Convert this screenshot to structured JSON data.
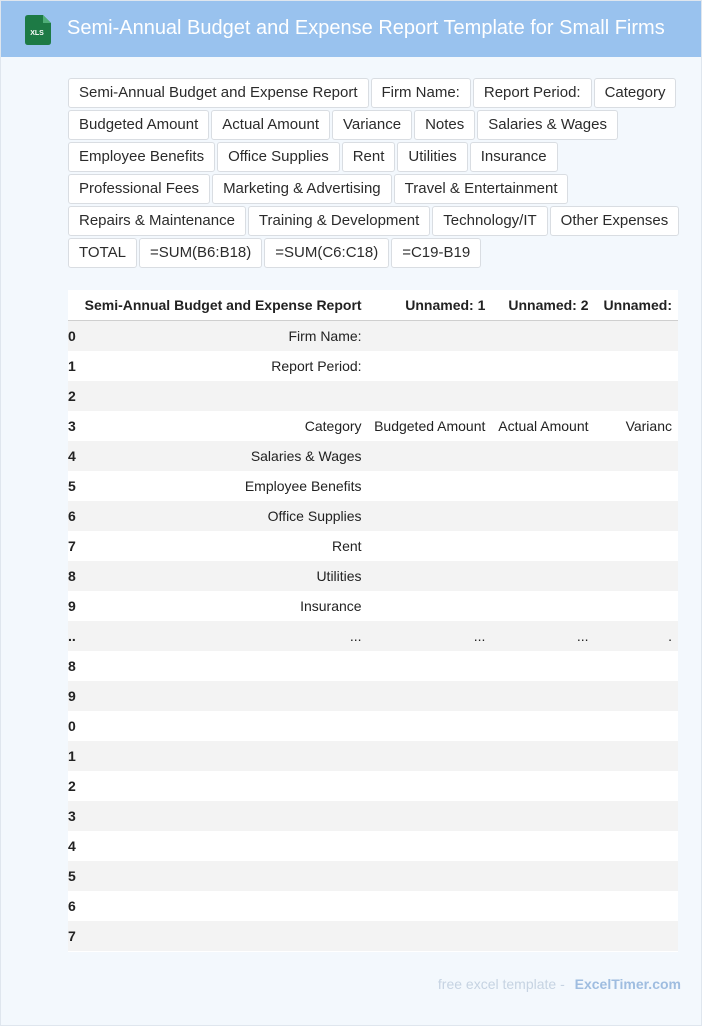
{
  "header": {
    "icon_text": "XLS",
    "title": "Semi-Annual Budget and Expense Report Template for Small Firms"
  },
  "tags": [
    "Semi-Annual Budget and Expense Report",
    "Firm Name:",
    "Report Period:",
    "Category",
    "Budgeted Amount",
    "Actual Amount",
    "Variance",
    "Notes",
    "Salaries & Wages",
    "Employee Benefits",
    "Office Supplies",
    "Rent",
    "Utilities",
    "Insurance",
    "Professional Fees",
    "Marketing & Advertising",
    "Travel & Entertainment",
    "Repairs & Maintenance",
    "Training & Development",
    "Technology/IT",
    "Other Expenses",
    "TOTAL",
    "=SUM(B6:B18)",
    "=SUM(C6:C18)",
    "=C19-B19"
  ],
  "table": {
    "columns": [
      "",
      "Semi-Annual Budget and Expense Report",
      "Unnamed: 1",
      "Unnamed: 2",
      "Unnamed:"
    ],
    "rows": [
      [
        "0",
        "Firm Name:",
        "",
        "",
        ""
      ],
      [
        "1",
        "Report Period:",
        "",
        "",
        ""
      ],
      [
        "2",
        "",
        "",
        "",
        ""
      ],
      [
        "3",
        "Category",
        "Budgeted Amount",
        "Actual Amount",
        "Varianc"
      ],
      [
        "4",
        "Salaries & Wages",
        "",
        "",
        ""
      ],
      [
        "5",
        "Employee Benefits",
        "",
        "",
        ""
      ],
      [
        "6",
        "Office Supplies",
        "",
        "",
        ""
      ],
      [
        "7",
        "Rent",
        "",
        "",
        ""
      ],
      [
        "8",
        "Utilities",
        "",
        "",
        ""
      ],
      [
        "9",
        "Insurance",
        "",
        "",
        ""
      ],
      [
        "..",
        "...",
        "...",
        "...",
        "."
      ],
      [
        "8",
        "",
        "",
        "",
        ""
      ],
      [
        "9",
        "",
        "",
        "",
        ""
      ],
      [
        "0",
        "",
        "",
        "",
        ""
      ],
      [
        "1",
        "",
        "",
        "",
        ""
      ],
      [
        "2",
        "",
        "",
        "",
        ""
      ],
      [
        "3",
        "",
        "",
        "",
        ""
      ],
      [
        "4",
        "",
        "",
        "",
        ""
      ],
      [
        "5",
        "",
        "",
        "",
        ""
      ],
      [
        "6",
        "",
        "",
        "",
        ""
      ],
      [
        "7",
        "",
        "",
        "",
        ""
      ]
    ]
  },
  "footer": {
    "text": "free excel template -",
    "brand": "ExcelTimer.com"
  },
  "colors": {
    "header_bg": "#99c2ee",
    "page_bg": "#f3f8fd",
    "icon_green": "#1d7a45"
  }
}
